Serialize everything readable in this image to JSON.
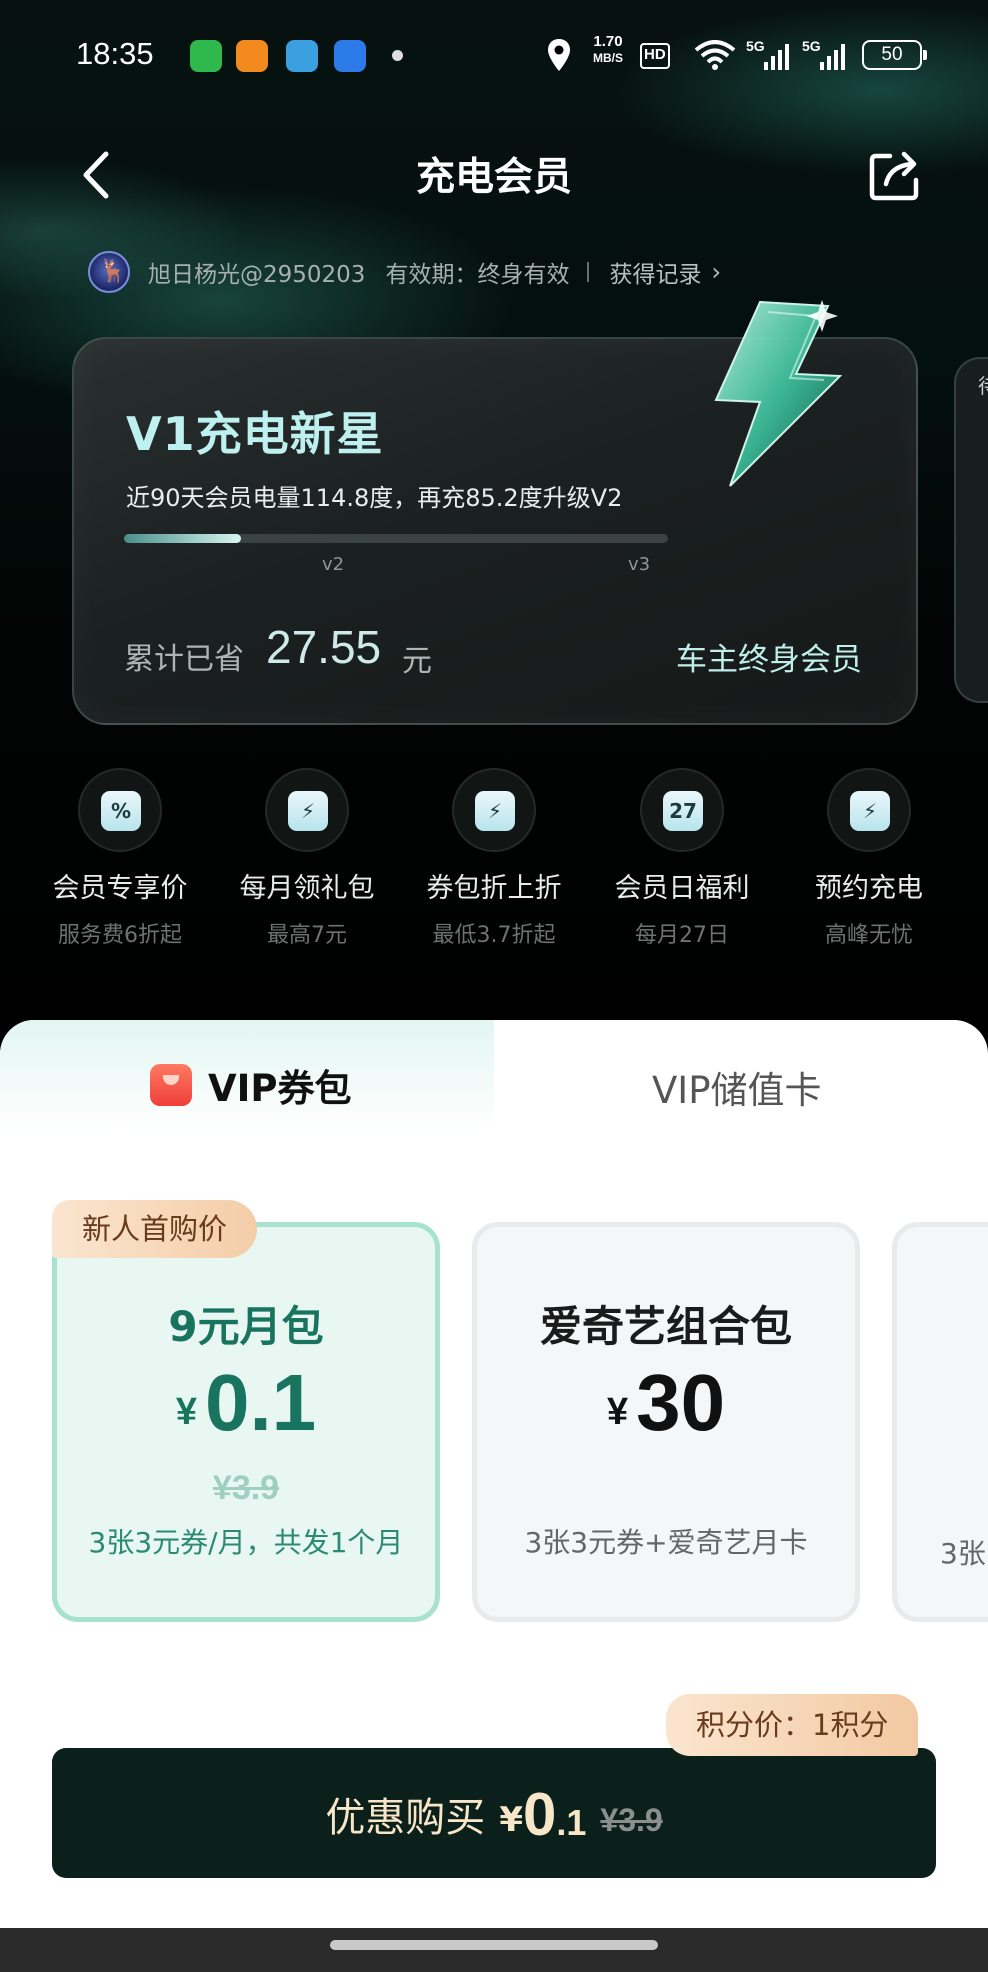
{
  "status_bar": {
    "time": "18:35",
    "net_speed_value": "1.70",
    "net_speed_unit": "MB/S",
    "hd": "HD",
    "sig1": "5G",
    "sig2": "5G",
    "battery": "50",
    "app_colors": [
      "#2fb84d",
      "#f28a1e",
      "#3aa0e0",
      "#2d7be8"
    ]
  },
  "header": {
    "title": "充电会员"
  },
  "user": {
    "name": "旭日杨光@2950203",
    "validity": "有效期：终身有效",
    "record_link": "获得记录"
  },
  "card": {
    "level_title": "V1充电新星",
    "description": "近90天会员电量114.8度，再充85.2度升级V2",
    "progress_fraction": 0.215,
    "tick_v2": "v2",
    "tick_v3": "v3",
    "saved_label": "累计已省",
    "saved_value": "27.55",
    "saved_unit": "元",
    "owner_label": "车主终身会员",
    "side_card_text": "待"
  },
  "benefits": [
    {
      "icon": "diamond-percent-icon",
      "glyph": "%",
      "title": "会员专享价",
      "sub": "服务费6折起"
    },
    {
      "icon": "gift-icon",
      "glyph": "⚡",
      "title": "每月领礼包",
      "sub": "最高7元"
    },
    {
      "icon": "coupon-icon",
      "glyph": "⚡",
      "title": "券包折上折",
      "sub": "最低3.7折起"
    },
    {
      "icon": "calendar-icon",
      "glyph": "27",
      "title": "会员日福利",
      "sub": "每月27日"
    },
    {
      "icon": "alarm-clock-icon",
      "glyph": "⚡",
      "title": "预约充电",
      "sub": "高峰无忧"
    }
  ],
  "tabs": {
    "tab1": "VIP券包",
    "tab2": "VIP储值卡"
  },
  "packages": [
    {
      "tag": "新人首购价",
      "name": "9元月包",
      "yen": "¥",
      "price": "0.1",
      "original": "¥3.9",
      "desc": "3张3元券/月，共发1个月"
    },
    {
      "name": "爱奇艺组合包",
      "yen": "¥",
      "price": "30",
      "desc": "3张3元券+爱奇艺月卡"
    },
    {
      "desc_partial": "3张"
    }
  ],
  "purchase": {
    "points_tag": "积分价：1积分",
    "label": "优惠购买",
    "yen": "¥",
    "price_int": "0",
    "price_dec": ".1",
    "original": "¥3.9"
  },
  "colors": {
    "accent_green": "#18735f",
    "tag_gold": "#f4cda8",
    "button_dark": "#0b1f1b"
  }
}
